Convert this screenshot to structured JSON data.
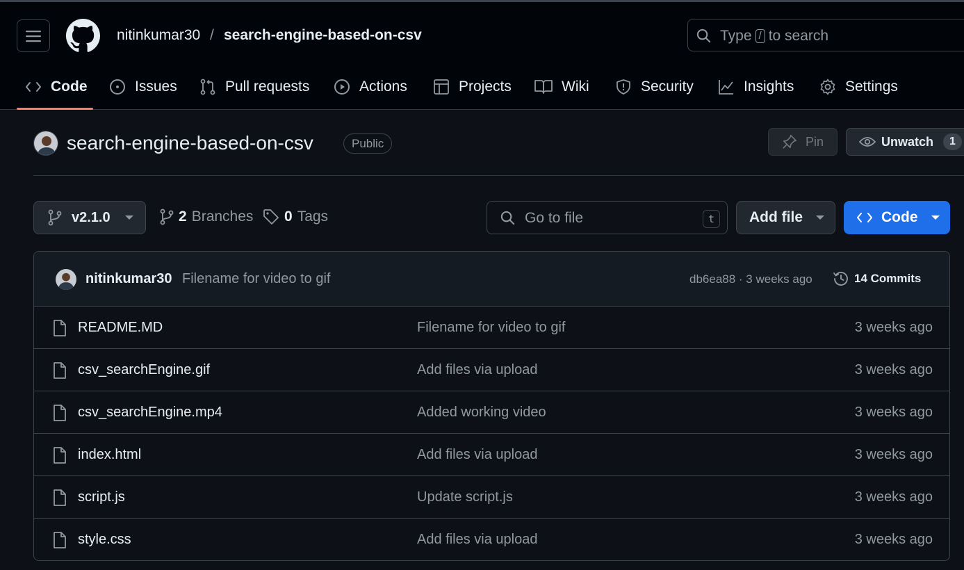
{
  "header": {
    "owner": "nitinkumar30",
    "separator": "/",
    "repo": "search-engine-based-on-csv",
    "search": {
      "prefix": "Type",
      "key": "/",
      "suffix": "to search"
    }
  },
  "tabs": [
    {
      "label": "Code",
      "icon": "code-icon",
      "selected": true
    },
    {
      "label": "Issues",
      "icon": "issue-opened-icon"
    },
    {
      "label": "Pull requests",
      "icon": "git-pull-request-icon"
    },
    {
      "label": "Actions",
      "icon": "play-icon"
    },
    {
      "label": "Projects",
      "icon": "table-icon"
    },
    {
      "label": "Wiki",
      "icon": "book-icon"
    },
    {
      "label": "Security",
      "icon": "shield-icon"
    },
    {
      "label": "Insights",
      "icon": "graph-icon"
    },
    {
      "label": "Settings",
      "icon": "gear-icon"
    }
  ],
  "repo_header": {
    "title": "search-engine-based-on-csv",
    "visibility": "Public",
    "pin_label": "Pin",
    "watch_label": "Unwatch",
    "watch_count": "1"
  },
  "toolbar": {
    "branch": "v2.1.0",
    "branches_count": "2",
    "branches_label": "Branches",
    "tags_count": "0",
    "tags_label": "Tags",
    "goto_placeholder": "Go to file",
    "goto_key": "t",
    "add_file_label": "Add file",
    "code_label": "Code"
  },
  "latest_commit": {
    "author": "nitinkumar30",
    "message": "Filename for video to gif",
    "hash_and_time": "db6ea88 · 3 weeks ago",
    "commits_label": "14 Commits"
  },
  "files": [
    {
      "name": "README.MD",
      "message": "Filename for video to gif",
      "date": "3 weeks ago"
    },
    {
      "name": "csv_searchEngine.gif",
      "message": "Add files via upload",
      "date": "3 weeks ago"
    },
    {
      "name": "csv_searchEngine.mp4",
      "message": "Added working video",
      "date": "3 weeks ago"
    },
    {
      "name": "index.html",
      "message": "Add files via upload",
      "date": "3 weeks ago"
    },
    {
      "name": "script.js",
      "message": "Update script.js",
      "date": "3 weeks ago"
    },
    {
      "name": "style.css",
      "message": "Add files via upload",
      "date": "3 weeks ago"
    }
  ],
  "colors": {
    "background": "#0d1117",
    "header_bg": "#010409",
    "accent_blue": "#1f6feb",
    "tab_underline": "#f78166",
    "muted_text": "#9198a1",
    "border": "#3d444d"
  }
}
